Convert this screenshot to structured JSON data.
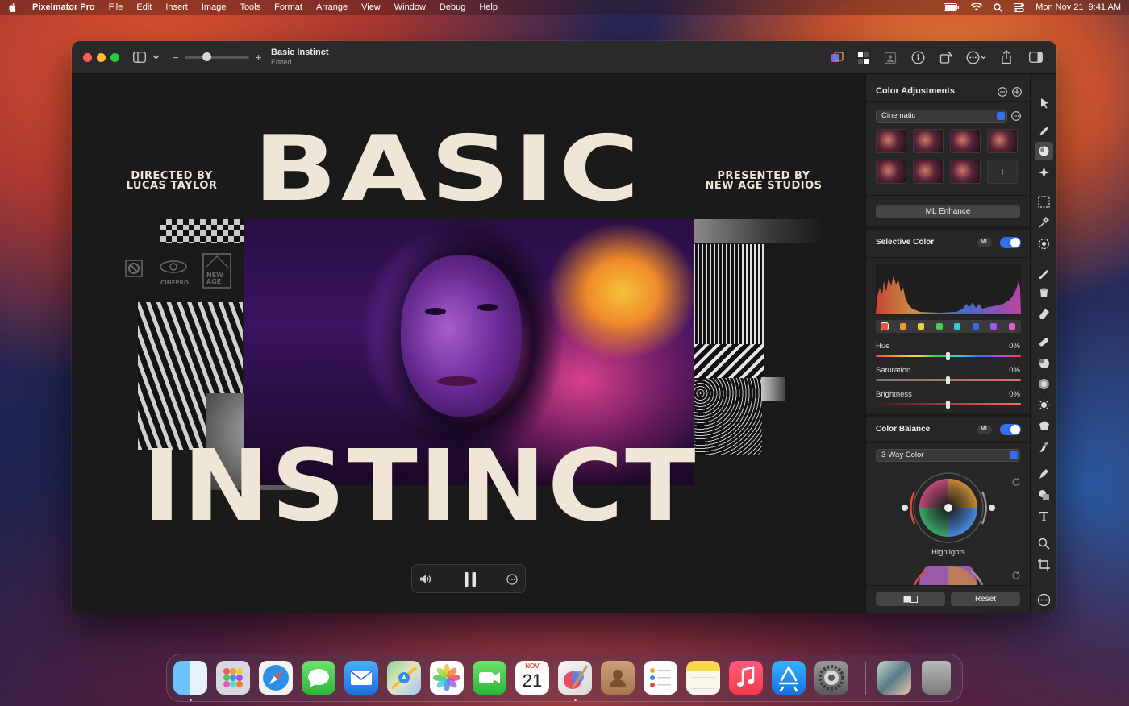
{
  "menubar": {
    "app_name": "Pixelmator Pro",
    "items": [
      "File",
      "Edit",
      "Insert",
      "Image",
      "Tools",
      "Format",
      "Arrange",
      "View",
      "Window",
      "Debug",
      "Help"
    ],
    "datetime": "Mon Nov 21  9:41 AM"
  },
  "window": {
    "title": "Basic Instinct",
    "subtitle": "Edited"
  },
  "poster": {
    "title_top": "BASIC",
    "title_bottom": "INSTINCT",
    "credit_left_line1": "DIRECTED BY",
    "credit_left_line2": "LUCAS TAYLOR",
    "credit_right_line1": "PRESENTED BY",
    "credit_right_line2": "NEW AGE STUDIOS",
    "logo_cinepro": "CINEPRO",
    "logo_newage": "NEW AGE"
  },
  "inspector": {
    "color_adjustments": {
      "title": "Color Adjustments",
      "preset": "Cinematic",
      "ml_enhance": "ML Enhance"
    },
    "selective_color": {
      "title": "Selective Color",
      "ml_badge": "ML",
      "enabled": true,
      "swatch_colors": [
        "#e8553a",
        "#f09a2a",
        "#e8d43a",
        "#4ac85a",
        "#3ac8d8",
        "#3a6ae8",
        "#9a5ae8",
        "#e85ad8"
      ],
      "sliders": [
        {
          "label": "Hue",
          "value": "0%"
        },
        {
          "label": "Saturation",
          "value": "0%"
        },
        {
          "label": "Brightness",
          "value": "0%"
        }
      ]
    },
    "color_balance": {
      "title": "Color Balance",
      "ml_badge": "ML",
      "enabled": true,
      "mode": "3-Way Color",
      "wheel_label": "Highlights"
    },
    "footer": {
      "reset": "Reset"
    }
  },
  "dock": {
    "calendar_month": "NOV",
    "calendar_day": "21"
  }
}
